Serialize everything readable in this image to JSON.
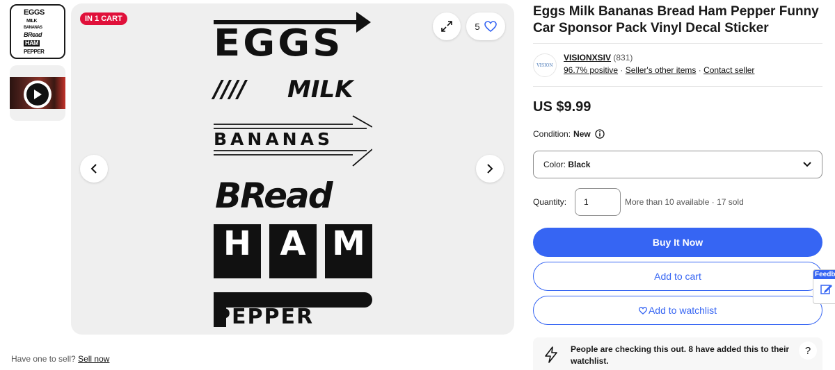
{
  "gallery": {
    "cart_badge": "IN 1 CART",
    "watch_count": "5",
    "sticker_lines": [
      "EGGS",
      "MILK",
      "BANANAS",
      "BRead",
      "H",
      "A",
      "M",
      "PEPPER",
      "////"
    ]
  },
  "thumbnails": {
    "mini_lines": [
      "EGGS",
      "MILK",
      "BANANAS",
      "BRead",
      "HAM",
      "PEPPER"
    ]
  },
  "sell": {
    "prompt": "Have one to sell?",
    "link": "Sell now"
  },
  "listing": {
    "title": "Eggs Milk Bananas Bread Ham Pepper Funny Car Sponsor Pack Vinyl Decal Sticker",
    "price": "US $9.99"
  },
  "seller": {
    "logo_text": "VISION",
    "name": "VISIONXSIV",
    "count": "(831)",
    "positive": "96.7% positive",
    "other_items": "Seller's other items",
    "contact": "Contact seller"
  },
  "condition": {
    "label": "Condition:",
    "value": "New"
  },
  "color_select": {
    "label": "Color:",
    "value": "Black"
  },
  "quantity": {
    "label": "Quantity:",
    "value": "1",
    "availability": "More than 10 available · 17 sold"
  },
  "buttons": {
    "buy": "Buy It Now",
    "cart": "Add to cart",
    "watch": "Add to watchlist"
  },
  "notice": {
    "text": "People are checking this out. 8 have added this to their watchlist."
  },
  "feedback": {
    "label": "Feedback"
  },
  "help": "?"
}
